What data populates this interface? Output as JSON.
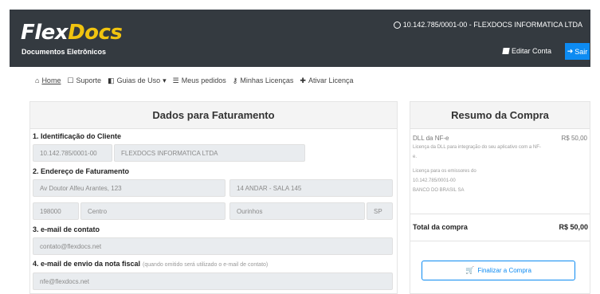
{
  "header": {
    "logo_main": "Flex",
    "logo_accent": "Docs",
    "logo_subtitle": "Documentos Eletrônicos",
    "company": "10.142.785/0001-00 - FLEXDOCS INFORMATICA LTDA",
    "edit_label": "Editar Conta",
    "exit_label": "Sair",
    "colors": {
      "bg": "#343a40",
      "accent": "#f1c40f",
      "primary": "#0d8bf2"
    }
  },
  "nav": {
    "items": [
      {
        "icon": "home-icon",
        "label": "Home"
      },
      {
        "icon": "support-icon",
        "label": "Suporte"
      },
      {
        "icon": "guides-icon",
        "label": "Guias de Uso"
      },
      {
        "icon": "orders-icon",
        "label": "Meus pedidos"
      },
      {
        "icon": "key-icon",
        "label": "Minhas Licenças"
      },
      {
        "icon": "plus-icon",
        "label": "Ativar Licença"
      }
    ]
  },
  "billing": {
    "title": "Dados para Faturamento",
    "s1_title": "1. Identificação do Cliente",
    "cnpj": "10.142.785/0001-00",
    "name": "FLEXDOCS INFORMATICA LTDA",
    "s2_title": "2. Endereço de Faturamento",
    "street": "Av Doutor Alfeu Arantes, 123",
    "complement": "14 ANDAR - SALA 145",
    "cep": "198000",
    "district": "Centro",
    "city": "Ourinhos",
    "state": "SP",
    "s3_title": "3. e-mail de contato",
    "contact_email": "contato@flexdocs.net",
    "s4_title": "4. e-mail de envio da nota fiscal",
    "s4_hint": "(quando omitido será utilizado o e-mail de contato)",
    "invoice_email": "nfe@flexdocs.net"
  },
  "summary": {
    "title": "Resumo da Compra",
    "item_name": "DLL da NF-e",
    "item_price": "R$ 50,00",
    "desc_lines": [
      "Licença da DLL para integração do seu aplicativo com a NF-",
      "e.",
      "Licença para os emissores do",
      "10.142.785/0001-00",
      "BANCO DO BRASIL SA"
    ],
    "total_label": "Total da compra",
    "total_value": "R$ 50,00",
    "finish_label": "Finalizar a Compra"
  }
}
